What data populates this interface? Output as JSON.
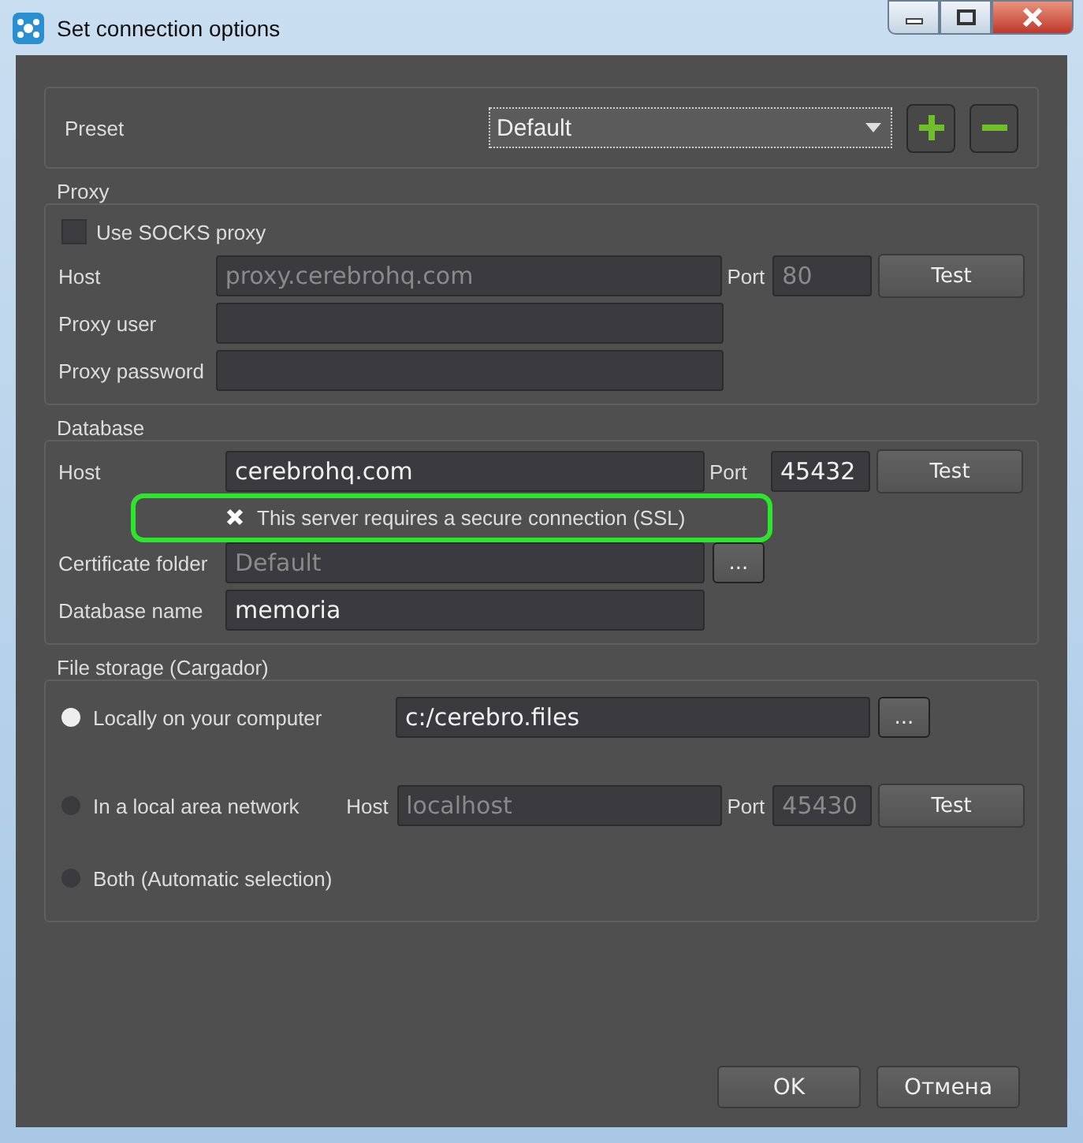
{
  "window": {
    "title": "Set connection options"
  },
  "preset": {
    "label": "Preset",
    "value": "Default"
  },
  "proxy": {
    "title": "Proxy",
    "use_socks": {
      "label": "Use SOCKS proxy",
      "checked": false
    },
    "host": {
      "label": "Host",
      "placeholder": "proxy.cerebrohq.com"
    },
    "port": {
      "label": "Port",
      "placeholder": "80"
    },
    "test": "Test",
    "user": {
      "label": "Proxy user"
    },
    "password": {
      "label": "Proxy password"
    }
  },
  "database": {
    "title": "Database",
    "host": {
      "label": "Host",
      "value": "cerebrohq.com"
    },
    "port": {
      "label": "Port",
      "value": "45432"
    },
    "test": "Test",
    "ssl": {
      "label": "This server requires a secure connection (SSL)",
      "checked": true,
      "highlighted": true
    },
    "cert_folder": {
      "label": "Certificate folder",
      "placeholder": "Default"
    },
    "browse": "...",
    "name": {
      "label": "Database name",
      "value": "memoria"
    }
  },
  "file_storage": {
    "title": "File storage (Cargador)",
    "options": [
      {
        "kind": "path",
        "label": "Locally on your computer",
        "selected": true,
        "value": "c:/cerebro.files",
        "browse": "..."
      },
      {
        "kind": "network",
        "label": "In a local area network",
        "selected": false,
        "host_label": "Host",
        "host_placeholder": "localhost",
        "port_label": "Port",
        "port_placeholder": "45430",
        "test": "Test"
      },
      {
        "kind": "plain",
        "label": "Both (Automatic selection)",
        "selected": false
      }
    ]
  },
  "buttons": [
    "OK",
    "Отмена"
  ]
}
